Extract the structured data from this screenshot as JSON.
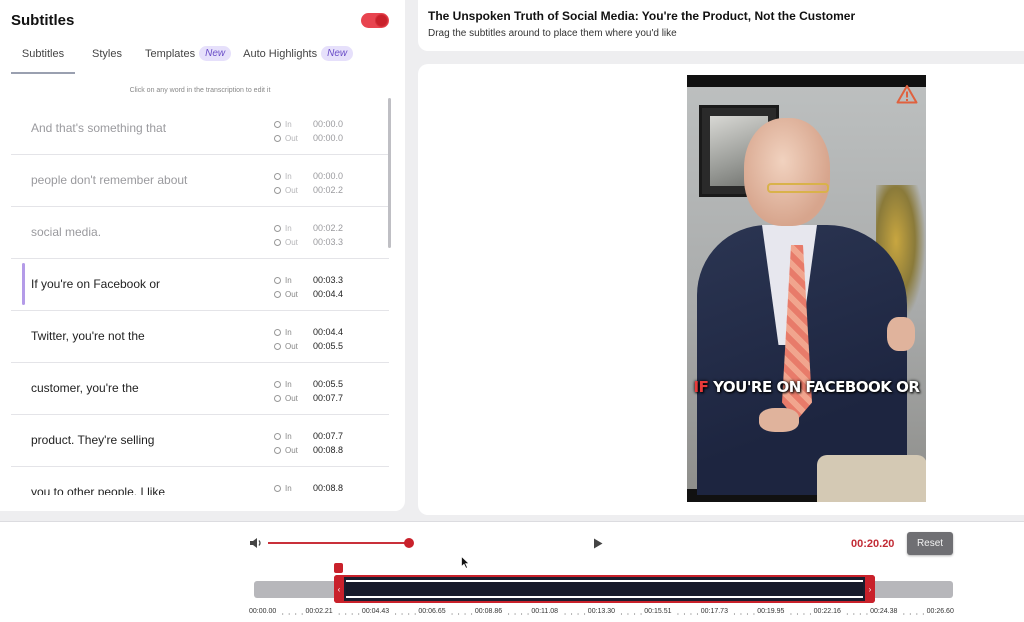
{
  "sidebar": {
    "title": "Subtitles",
    "toggle_on": true,
    "tabs": [
      {
        "label": "Subtitles",
        "badge": ""
      },
      {
        "label": "Styles",
        "badge": ""
      },
      {
        "label": "Templates",
        "badge": "New"
      },
      {
        "label": "Auto Highlights",
        "badge": "New"
      }
    ],
    "hint": "Click on any word in the transcription to edit it",
    "in_label": "In",
    "out_label": "Out",
    "rows": [
      {
        "text": "And that's something that",
        "in": "00:00.0",
        "out": "00:00.0",
        "state": "faded"
      },
      {
        "text": "people don't remember about",
        "in": "00:00.0",
        "out": "00:02.2",
        "state": "faded"
      },
      {
        "text": "social media.",
        "in": "00:02.2",
        "out": "00:03.3",
        "state": "faded"
      },
      {
        "text": "If you're on Facebook or",
        "in": "00:03.3",
        "out": "00:04.4",
        "state": "active"
      },
      {
        "text": "Twitter, you're not the",
        "in": "00:04.4",
        "out": "00:05.5",
        "state": "normal"
      },
      {
        "text": "customer, you're the",
        "in": "00:05.5",
        "out": "00:07.7",
        "state": "normal"
      },
      {
        "text": "product. They're selling",
        "in": "00:07.7",
        "out": "00:08.8",
        "state": "normal"
      },
      {
        "text": "you to other people. I like",
        "in": "00:08.8",
        "out": "",
        "state": "normal"
      }
    ]
  },
  "header": {
    "title": "The Unspoken Truth of Social Media: You're the Product, Not the Customer",
    "subtitle": "Drag the subtitles around to place them where you'd like"
  },
  "video": {
    "caption_highlight": "IF",
    "caption_rest": " YOU'RE ON FACEBOOK OR",
    "warning_icon": "warning-triangle-icon"
  },
  "player": {
    "volume_fraction": 1.0,
    "time": "00:20.20",
    "reset_label": "Reset",
    "accent": "#c9212b"
  },
  "timeline": {
    "ticks": [
      "00:00.00",
      "00:02.21",
      "00:04.43",
      "00:06.65",
      "00:08.86",
      "00:11.08",
      "00:13.30",
      "00:15.51",
      "00:17.73",
      "00:19.95",
      "00:22.16",
      "00:24.38",
      "00:26.60"
    ]
  }
}
